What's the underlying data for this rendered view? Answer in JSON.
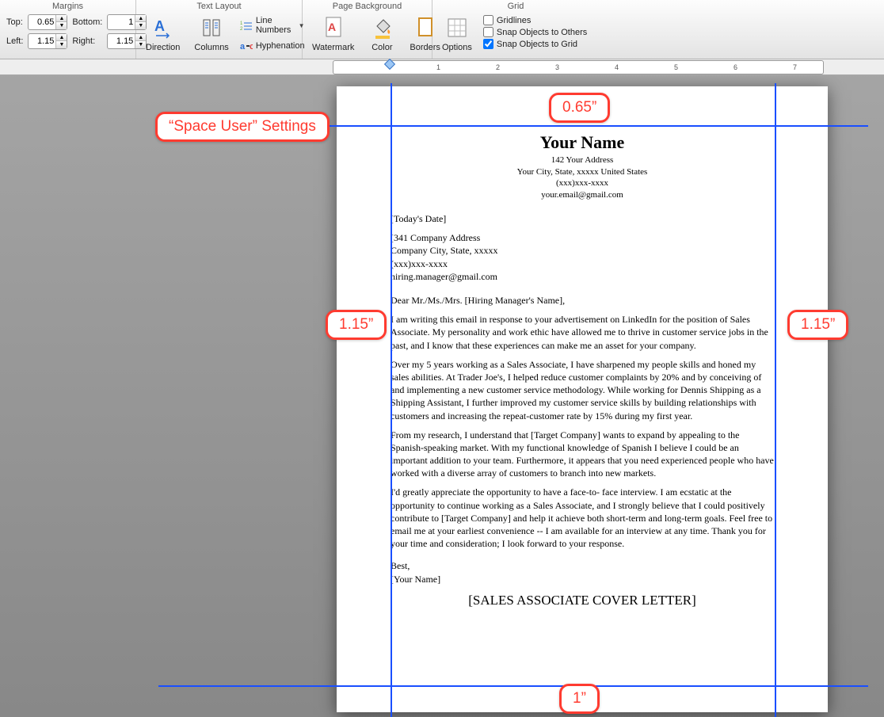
{
  "ribbon": {
    "margins": {
      "title": "Margins",
      "topLabel": "Top:",
      "topValue": "0.65",
      "bottomLabel": "Bottom:",
      "bottomValue": "1",
      "leftLabel": "Left:",
      "leftValue": "1.15",
      "rightLabel": "Right:",
      "rightValue": "1.15"
    },
    "textLayout": {
      "title": "Text Layout",
      "direction": "Direction",
      "columns": "Columns",
      "lineNumbers": "Line Numbers",
      "hyphenation": "Hyphenation"
    },
    "pageBackground": {
      "title": "Page Background",
      "watermark": "Watermark",
      "color": "Color",
      "borders": "Borders"
    },
    "grid": {
      "title": "Grid",
      "options": "Options",
      "gridlines": "Gridlines",
      "snapOthers": "Snap Objects to Others",
      "snapGrid": "Snap Objects to Grid"
    }
  },
  "ruler": {
    "marks": [
      "1",
      "2",
      "3",
      "4",
      "5",
      "6",
      "7"
    ]
  },
  "annotations": {
    "spaceUser": "“Space User” Settings",
    "top": "0.65”",
    "left": "1.15”",
    "right": "1.15”",
    "bottom": "1”"
  },
  "document": {
    "name": "Your Name",
    "addr1": "142 Your Address",
    "addr2": "Your City, State, xxxxx United States",
    "phone": "(xxx)xxx-xxxx",
    "email": "your.email@gmail.com",
    "date": "[Today's Date]",
    "compAddr": "[341 Company Address",
    "compCity": "Company City, State, xxxxx",
    "compPhone": "(xxx)xxx-xxxx",
    "compEmail": "hiring.manager@gmail.com",
    "salutation": "Dear Mr./Ms./Mrs. [Hiring Manager's Name],",
    "p1": "I am writing this email in response to your advertisement on LinkedIn for the position of Sales Associate. My personality and work ethic have allowed me to thrive in customer service jobs in the past, and I know that these experiences can make me an asset for your company.",
    "p2": "Over my 5 years working as a Sales Associate, I have sharpened my people skills and honed my sales abilities. At Trader Joe's, I helped reduce customer complaints by 20% and by conceiving of and implementing a new customer service methodology. While working for Dennis Shipping as a Shipping Assistant, I further improved my customer service skills by building relationships with customers and increasing the repeat-customer rate by 15% during my first year.",
    "p3": "From my research, I understand that [Target Company] wants to expand by appealing to the Spanish-speaking market. With my functional knowledge of Spanish I believe I could be an important addition to your team. Furthermore, it appears that you need experienced people who have worked with a diverse array of customers to branch into new markets.",
    "p4": "I'd greatly appreciate the opportunity to have a face-to- face interview. I am ecstatic at the opportunity to continue working as a Sales Associate, and I strongly believe that I could positively contribute to [Target Company] and help it achieve both short-term and long-term goals. Feel free to email me at your earliest convenience -- I am available for an interview at any time. Thank you for your time and consideration; I look forward to your response.",
    "closing": "Best,",
    "sig": "[Your Name]",
    "coverTitle": "[SALES ASSOCIATE COVER LETTER]"
  }
}
